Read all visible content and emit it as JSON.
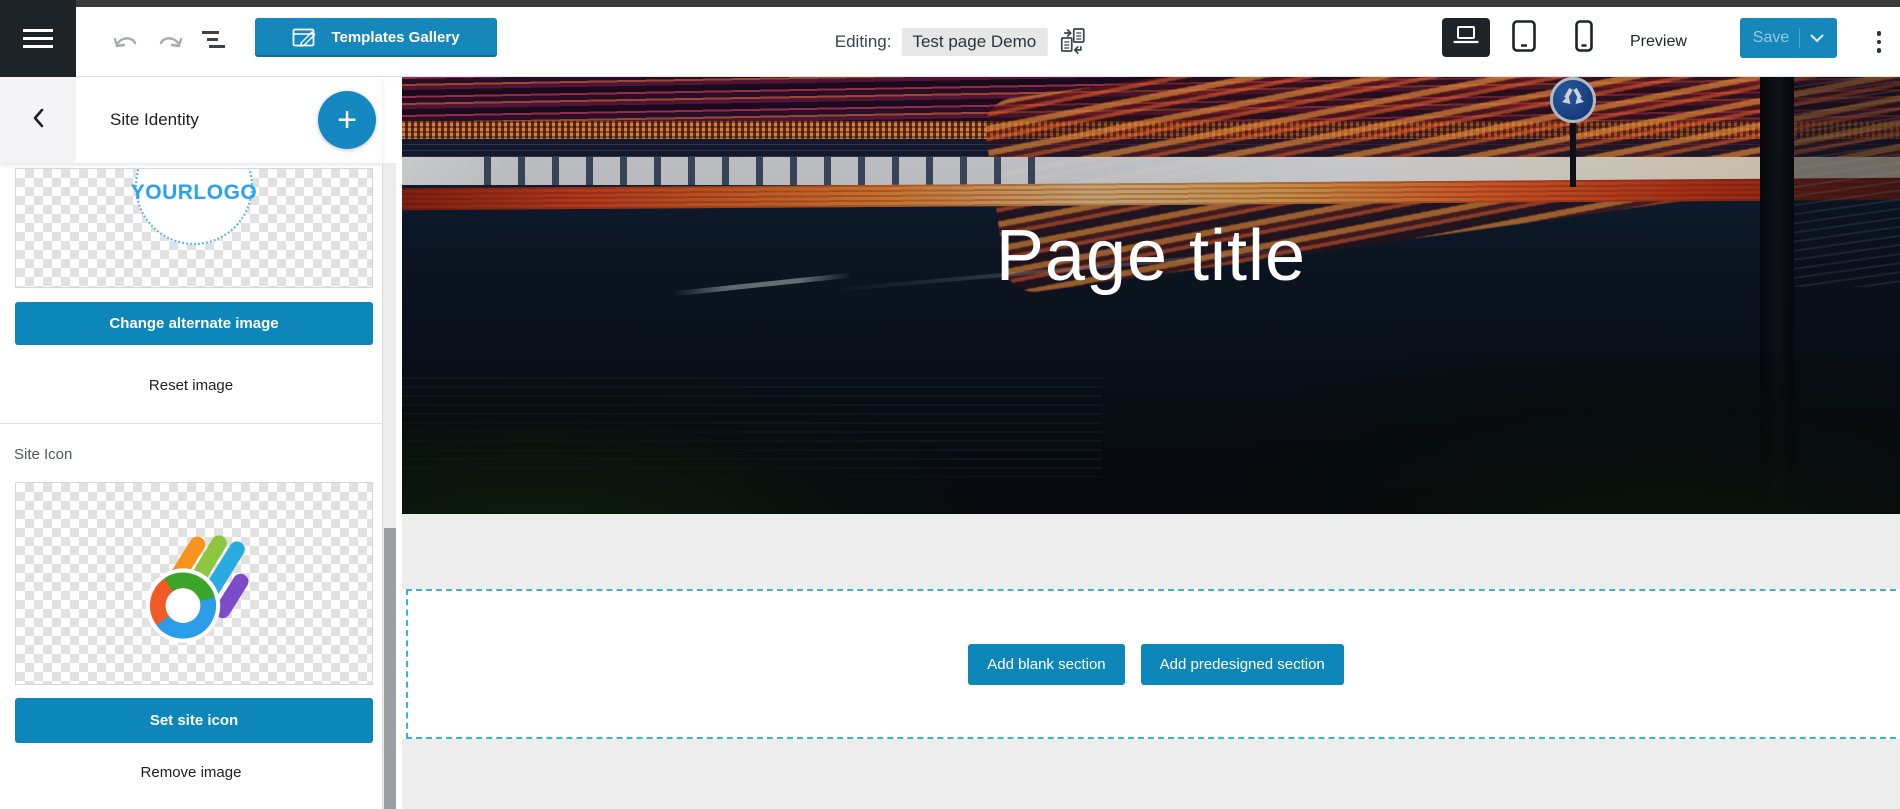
{
  "topbar": {
    "editing_label": "Editing:",
    "page_name": "Test page Demo",
    "templates_gallery_label": "Templates Gallery",
    "preview_label": "Preview",
    "save_label": "Save"
  },
  "sidebar": {
    "title": "Site Identity",
    "logo_placeholder_text": "YOURLOGO",
    "change_alternate_image_label": "Change alternate image",
    "reset_image_label": "Reset image",
    "site_icon_heading": "Site Icon",
    "set_site_icon_label": "Set site icon",
    "remove_image_label": "Remove image"
  },
  "canvas": {
    "page_title": "Page title",
    "add_blank_section_label": "Add blank section",
    "add_predesigned_section_label": "Add predesigned section"
  },
  "icons": {
    "plus": "+",
    "hamburger": "three-bars",
    "undo": "curved-arrow-left",
    "redo": "curved-arrow-right",
    "outline_steps": "three-staggered-bars",
    "templates_pencil": "pencil-in-frame",
    "switch_template": "two-docs-with-arrows",
    "desktop_preview": "laptop-outline",
    "tablet_preview": "tablet-outline",
    "mobile_preview": "phone-outline",
    "save_chevron": "chevron-down",
    "kebab": "three-dots-vertical",
    "back_chevron": "chevron-left",
    "site_icon_logo": "colibri-swirl-with-streaks",
    "traffic_sign": "blue-circle-arrows"
  },
  "colors": {
    "accent_blue": "#1587bb",
    "button_blue": "#0d86ba",
    "active_device_bg": "#1d2327",
    "editing_chip_bg": "#e7e7e8",
    "dashed_border": "#3ab4d5",
    "logo_text_blue": "#29a3f1",
    "canvas_band_gray": "#ededee",
    "top_strip_gray": "#3a3a3a"
  }
}
